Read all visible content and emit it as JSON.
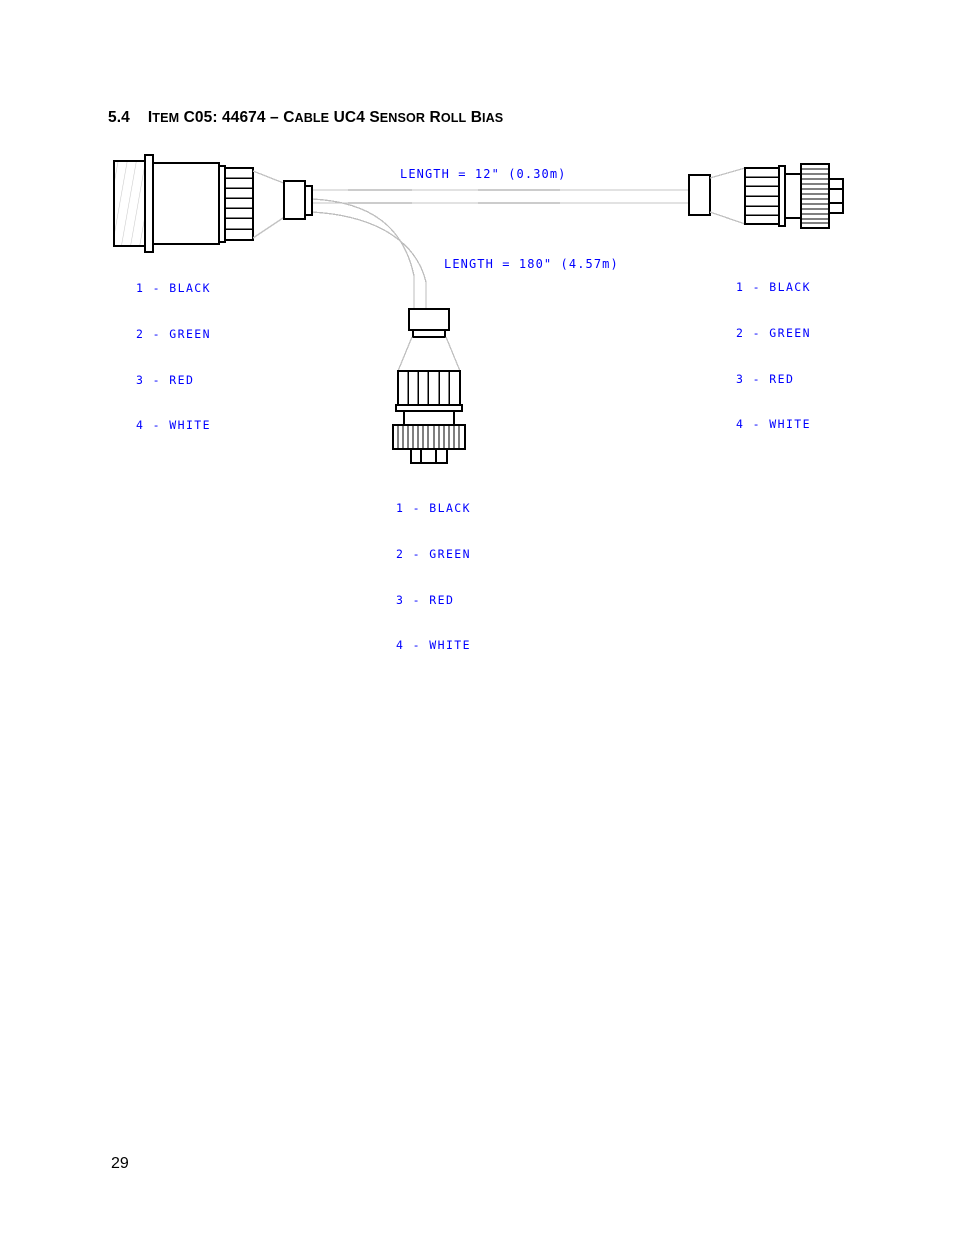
{
  "document": {
    "section_number": "5.4",
    "heading_text": "ITEM C05: 44674 – CABLE UC4 SENSOR ROLL BIAS",
    "heading_parts": {
      "item": "ITEM",
      "code": "C05:",
      "part_number": "44674",
      "dash": "–",
      "cable": "CABLE",
      "model": "UC4",
      "sensor": "SENSOR",
      "roll": "ROLL",
      "bias": "BIAS"
    },
    "page_number": "29"
  },
  "diagram": {
    "type": "cable-assembly-drawing",
    "labels": {
      "length_main": "LENGTH = 12\" (0.30m)",
      "length_branch": "LENGTH = 180\" (4.57m)"
    },
    "pinout_left": {
      "lines": [
        "1 - BLACK",
        "2 - GREEN",
        "3 - RED",
        "4 - WHITE"
      ]
    },
    "pinout_right": {
      "lines": [
        "1 - BLACK",
        "2 - GREEN",
        "3 - RED",
        "4 - WHITE"
      ]
    },
    "pinout_bottom": {
      "lines": [
        "1 - BLACK",
        "2 - GREEN",
        "3 - RED",
        "4 - WHITE"
      ]
    },
    "colors": {
      "annotation": "#0000ff",
      "line": "#000000",
      "cable": "#b9b9b9",
      "hatch": "#c9c9c9",
      "background": "#ffffff"
    }
  }
}
